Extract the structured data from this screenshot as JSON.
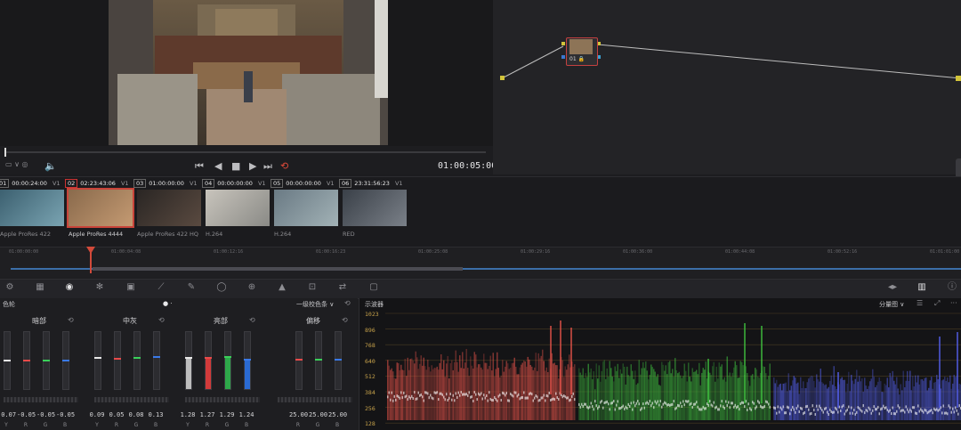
{
  "viewer": {
    "timecode": "01:00:05:00",
    "transport": {
      "first": "⏮",
      "prev": "◀",
      "stop": "■",
      "play": "▶",
      "last": "⏭",
      "loop": "⟲"
    }
  },
  "node_editor": {
    "node_label": "01 🔒"
  },
  "clips": [
    {
      "num": "01",
      "tc": "00:00:24:00",
      "track": "V1",
      "codec": "Apple ProRes 422",
      "selected": false
    },
    {
      "num": "02",
      "tc": "02:23:43:06",
      "track": "V1",
      "codec": "Apple ProRes 4444",
      "selected": true
    },
    {
      "num": "03",
      "tc": "01:00:00:00",
      "track": "V1",
      "codec": "Apple ProRes 422 HQ",
      "selected": false
    },
    {
      "num": "04",
      "tc": "00:00:00:00",
      "track": "V1",
      "codec": "H.264",
      "selected": false
    },
    {
      "num": "05",
      "tc": "00:00:00:00",
      "track": "V1",
      "codec": "H.264",
      "selected": false
    },
    {
      "num": "06",
      "tc": "23:31:56:23",
      "track": "V1",
      "codec": "RED",
      "selected": false
    }
  ],
  "timeline_ruler": [
    "01:00:00:00",
    "01:00:04:08",
    "01:00:12:16",
    "01:00:16:23",
    "01:00:25:08",
    "01:00:29:16",
    "01:00:36:00",
    "01:00:44:08",
    "01:00:52:16",
    "01:01:01:00"
  ],
  "color_panel": {
    "header_left": "色轮",
    "mode_select": "一级校色条",
    "wheels": [
      {
        "title": "暗部",
        "values": [
          "-0.07",
          "-0.05",
          "-0.05",
          "-0.05"
        ],
        "levels": [
          0.48,
          0.48,
          0.48,
          0.48
        ]
      },
      {
        "title": "中灰",
        "values": [
          "0.09",
          "0.05",
          "0.08",
          "0.13"
        ],
        "levels": [
          0.53,
          0.52,
          0.53,
          0.55
        ]
      },
      {
        "title": "亮部",
        "values": [
          "1.28",
          "1.27",
          "1.29",
          "1.24"
        ],
        "levels": [
          0.53,
          0.53,
          0.54,
          0.5
        ]
      },
      {
        "title": "偏移",
        "values": [
          "25.00",
          "25.00",
          "25.00"
        ],
        "levels": [
          0.5,
          0.5,
          0.5
        ]
      }
    ],
    "channel_labels": [
      "Y",
      "R",
      "G",
      "B"
    ]
  },
  "scope": {
    "title": "示波器",
    "mode": "分量图",
    "scale": [
      "1023",
      "896",
      "768",
      "640",
      "512",
      "384",
      "256",
      "128"
    ]
  },
  "colors": {
    "red": "#e8534a",
    "green": "#3fc23f",
    "blue": "#5460f0",
    "accent": "#d24a3a"
  }
}
